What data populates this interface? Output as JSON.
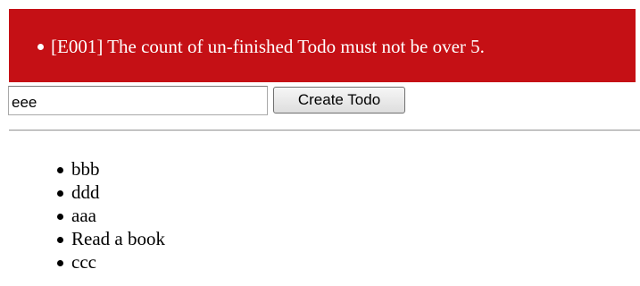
{
  "errors": {
    "background_color": "#c51015",
    "text_color": "#ffffff",
    "messages": [
      "[E001] The count of un-finished Todo must not be over 5."
    ]
  },
  "form": {
    "input_value": "eee",
    "button_label": "Create Todo"
  },
  "todos": {
    "items": [
      {
        "title": "bbb"
      },
      {
        "title": "ddd"
      },
      {
        "title": "aaa"
      },
      {
        "title": "Read a book"
      },
      {
        "title": "ccc"
      }
    ]
  }
}
